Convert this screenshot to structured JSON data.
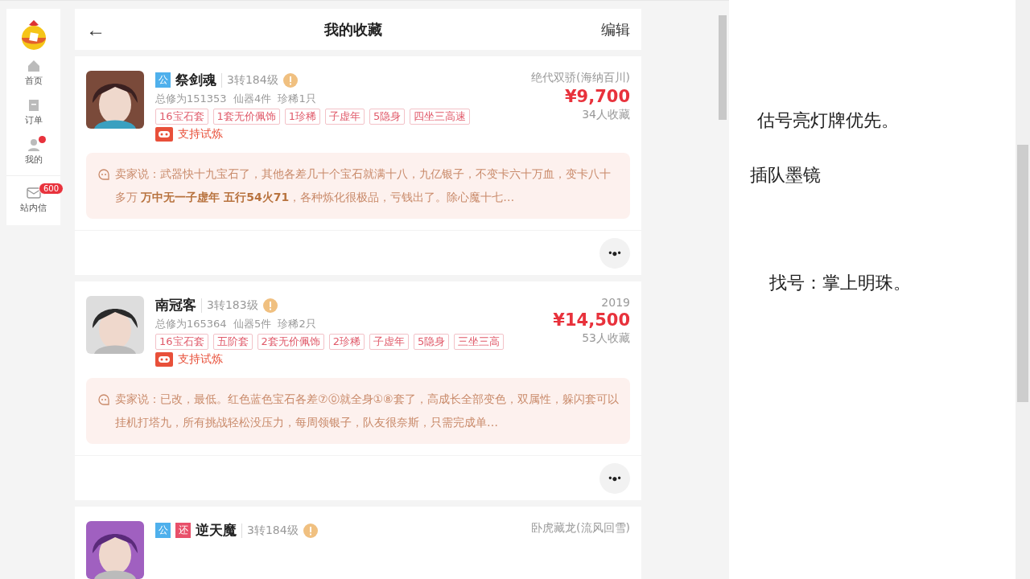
{
  "sidebar": {
    "items": [
      {
        "label": "首页",
        "kind": "home",
        "selected": false,
        "dot": false
      },
      {
        "label": "订单",
        "kind": "orders",
        "selected": false,
        "dot": false
      },
      {
        "label": "我的",
        "kind": "profile",
        "selected": false,
        "dot": true
      },
      {
        "label": "站内信",
        "kind": "mail",
        "selected": false,
        "dot": false,
        "badge": "600"
      }
    ]
  },
  "header": {
    "back": "←",
    "title": "我的收藏",
    "action": "编辑"
  },
  "listings": [
    {
      "badges": [
        {
          "text": "公",
          "kind": "public"
        }
      ],
      "name": "祭剑魂",
      "level": "3转184级",
      "server": "绝代双骄(海纳百川)",
      "stats": "总修为151353  仙器4件  珍稀1只",
      "price": "¥9,700",
      "favorites": "34人收藏",
      "tags": [
        "16宝石套",
        "1套无价佩饰",
        "1珍稀",
        "子虚年",
        "5隐身",
        "四坐三高速"
      ],
      "trial": "支持试炼",
      "note": "卖家说：武器快十九宝石了，其他各差几十个宝石就满十八，九亿银子，不变卡六十万血，变卡八十多万 **万中无一子虚年 五行54火71**，各种炼化很极品，亏钱出了。除心魔十七…",
      "more": "•●•"
    },
    {
      "name": "南冠客",
      "level": "3转183级",
      "server": "2019",
      "stats": "总修为165364  仙器5件  珍稀2只",
      "price": "¥14,500",
      "favorites": "53人收藏",
      "tags": [
        "16宝石套",
        "五阶套",
        "2套无价佩饰",
        "2珍稀",
        "子虚年",
        "5隐身",
        "三坐三高"
      ],
      "trial": "支持试炼",
      "note": "卖家说：已改，最低。红色蓝色宝石各差⑦⓪就全身①⑧套了，高成长全部变色，双属性，躲闪套可以挂机打塔九，所有挑战轻松没压力，每周领银子，队友很奈斯，只需完成单…",
      "more": "•●•"
    },
    {
      "badges": [
        {
          "text": "公",
          "kind": "public"
        },
        {
          "text": "还",
          "kind": "return"
        }
      ],
      "name": "逆天魔",
      "level": "3转184级",
      "server": "卧虎藏龙(流风回雪)"
    }
  ],
  "notes": [
    "估号亮灯牌优先。",
    "插队墨镜",
    "找号：掌上明珠。"
  ]
}
